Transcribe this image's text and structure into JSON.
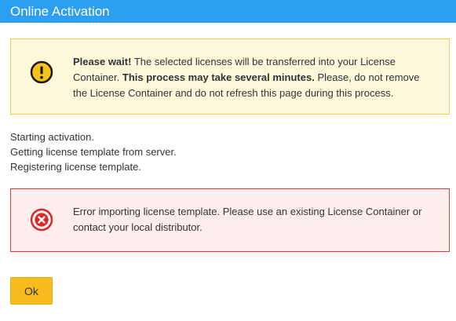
{
  "window": {
    "title": "Online Activation"
  },
  "warning": {
    "icon": "exclamation-circle-icon",
    "strong_lead": "Please wait!",
    "text_1": " The selected licenses will be transferred into your License Container. ",
    "strong_middle": "This process may take several minutes.",
    "text_2": " Please, do not remove the License Container and do not refresh this page during this process.",
    "colors": {
      "background": "#fdf7dc",
      "border": "#f2cc4c",
      "icon": "#f6c31c"
    }
  },
  "status_log": [
    "Starting activation.",
    "Getting license template from server.",
    "Registering license template."
  ],
  "error": {
    "icon": "x-circle-icon",
    "text": "Error importing license template. Please use an existing License Container or contact your local distributor.",
    "colors": {
      "background": "#fdeeee",
      "border": "#d43a3a",
      "icon": "#d62b2b"
    }
  },
  "actions": {
    "ok_label": "Ok",
    "ok_color": "#f6bb1d"
  },
  "theme": {
    "title_bar": "#2d9ff0"
  }
}
